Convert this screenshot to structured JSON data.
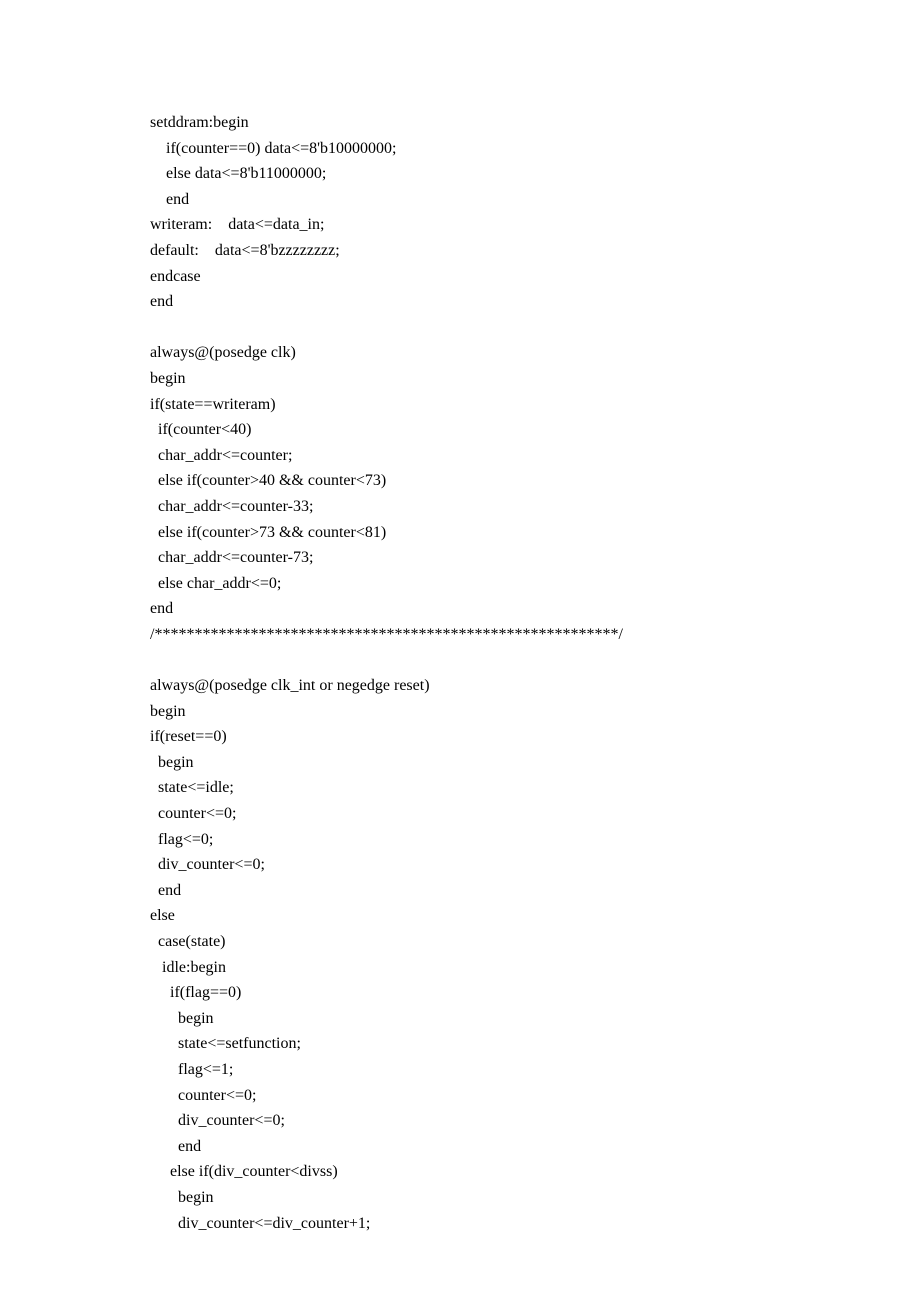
{
  "code": {
    "lines": [
      "setddram:begin",
      "    if(counter==0) data<=8'b10000000;",
      "    else data<=8'b11000000;",
      "    end",
      "writeram:    data<=data_in;",
      "default:    data<=8'bzzzzzzzz;",
      "endcase",
      "end",
      "",
      "always@(posedge clk)",
      "begin",
      "if(state==writeram)",
      "  if(counter<40)",
      "  char_addr<=counter;",
      "  else if(counter>40 && counter<73)",
      "  char_addr<=counter-33;",
      "  else if(counter>73 && counter<81)",
      "  char_addr<=counter-73;",
      "  else char_addr<=0;",
      "end",
      "/**********************************************************/",
      "",
      "always@(posedge clk_int or negedge reset)",
      "begin",
      "if(reset==0)",
      "  begin",
      "  state<=idle;",
      "  counter<=0;",
      "  flag<=0;",
      "  div_counter<=0;",
      "  end",
      "else",
      "  case(state)",
      "   idle:begin",
      "     if(flag==0)",
      "       begin",
      "       state<=setfunction;",
      "       flag<=1;",
      "       counter<=0;",
      "       div_counter<=0;",
      "       end",
      "     else if(div_counter<divss)",
      "       begin",
      "       div_counter<=div_counter+1;"
    ]
  }
}
